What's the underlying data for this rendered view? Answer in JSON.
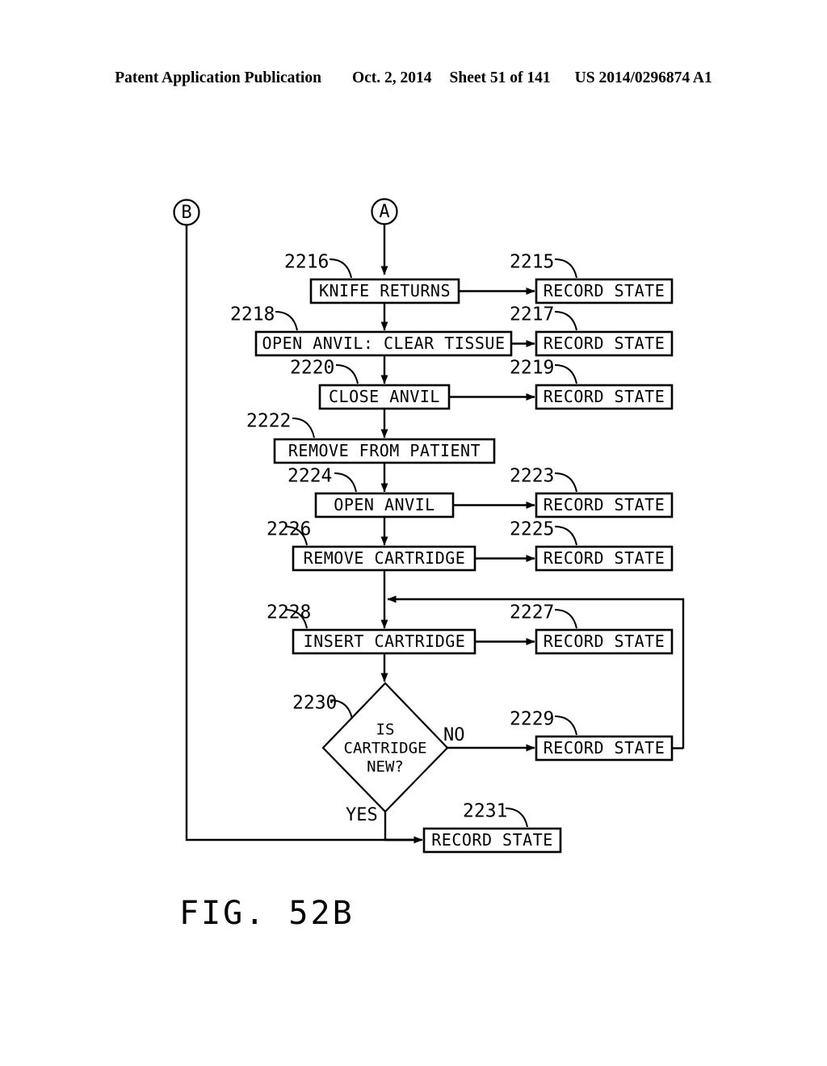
{
  "header": {
    "publication": "Patent Application Publication",
    "date": "Oct. 2, 2014",
    "sheet": "Sheet 51 of 141",
    "patent_number": "US 2014/0296874 A1"
  },
  "figure": {
    "caption": "FIG. 52B"
  },
  "connectors": [
    {
      "id": "B",
      "label": "B"
    },
    {
      "id": "A",
      "label": "A"
    }
  ],
  "process_steps": [
    {
      "ref": "2216",
      "label": "KNIFE RETURNS"
    },
    {
      "ref": "2218",
      "label": "OPEN ANVIL: CLEAR TISSUE"
    },
    {
      "ref": "2220",
      "label": "CLOSE ANVIL"
    },
    {
      "ref": "2222",
      "label": "REMOVE FROM PATIENT"
    },
    {
      "ref": "2224",
      "label": "OPEN ANVIL"
    },
    {
      "ref": "2226",
      "label": "REMOVE CARTRIDGE"
    },
    {
      "ref": "2228",
      "label": "INSERT CARTRIDGE"
    }
  ],
  "decision": {
    "ref": "2230",
    "line1": "IS",
    "line2": "CARTRIDGE",
    "line3": "NEW?",
    "yes_label": "YES",
    "no_label": "NO"
  },
  "record_states": [
    {
      "ref": "2215",
      "label": "RECORD STATE"
    },
    {
      "ref": "2217",
      "label": "RECORD STATE"
    },
    {
      "ref": "2219",
      "label": "RECORD STATE"
    },
    {
      "ref": "2223",
      "label": "RECORD STATE"
    },
    {
      "ref": "2225",
      "label": "RECORD STATE"
    },
    {
      "ref": "2227",
      "label": "RECORD STATE"
    },
    {
      "ref": "2229",
      "label": "RECORD STATE"
    },
    {
      "ref": "2231",
      "label": "RECORD STATE"
    }
  ],
  "colors": {
    "ink": "#000000",
    "paper": "#ffffff"
  }
}
